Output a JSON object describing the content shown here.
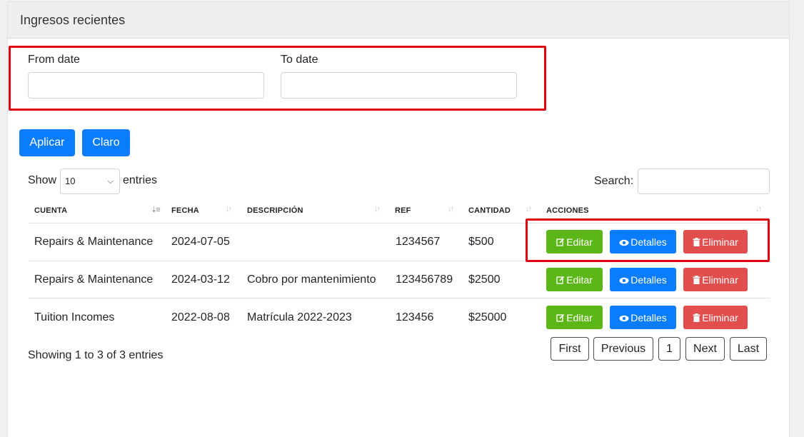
{
  "card": {
    "title": "Ingresos recientes"
  },
  "filters": {
    "from_label": "From date",
    "to_label": "To date",
    "from_value": "",
    "to_value": "",
    "apply_label": "Aplicar",
    "clear_label": "Claro"
  },
  "table_controls": {
    "show_label": "Show",
    "entries_value": "10",
    "entries_label": "entries",
    "search_label": "Search:",
    "search_value": ""
  },
  "table": {
    "columns": [
      "CUENTA",
      "FECHA",
      "DESCRIPCIÓN",
      "REF",
      "CANTIDAD",
      "ACCIONES"
    ],
    "rows": [
      {
        "cuenta": "Repairs & Maintenance",
        "fecha": "2024-07-05",
        "descripcion": "",
        "ref": "1234567",
        "cantidad": "$500"
      },
      {
        "cuenta": "Repairs & Maintenance",
        "fecha": "2024-03-12",
        "descripcion": "Cobro por mantenimiento",
        "ref": "123456789",
        "cantidad": "$2500"
      },
      {
        "cuenta": "Tuition Incomes",
        "fecha": "2022-08-08",
        "descripcion": "Matrícula 2022-2023",
        "ref": "123456",
        "cantidad": "$25000"
      }
    ],
    "actions": {
      "edit": "Editar",
      "view": "Detalles",
      "delete": "Eliminar"
    }
  },
  "footer": {
    "info": "Showing 1 to 3 of 3 entries",
    "pagination": {
      "first": "First",
      "previous": "Previous",
      "current": "1",
      "next": "Next",
      "last": "Last"
    }
  },
  "colors": {
    "primary": "#0a7cff",
    "success": "#5cb617",
    "danger": "#e24e4e",
    "highlight": "#e0000f"
  }
}
